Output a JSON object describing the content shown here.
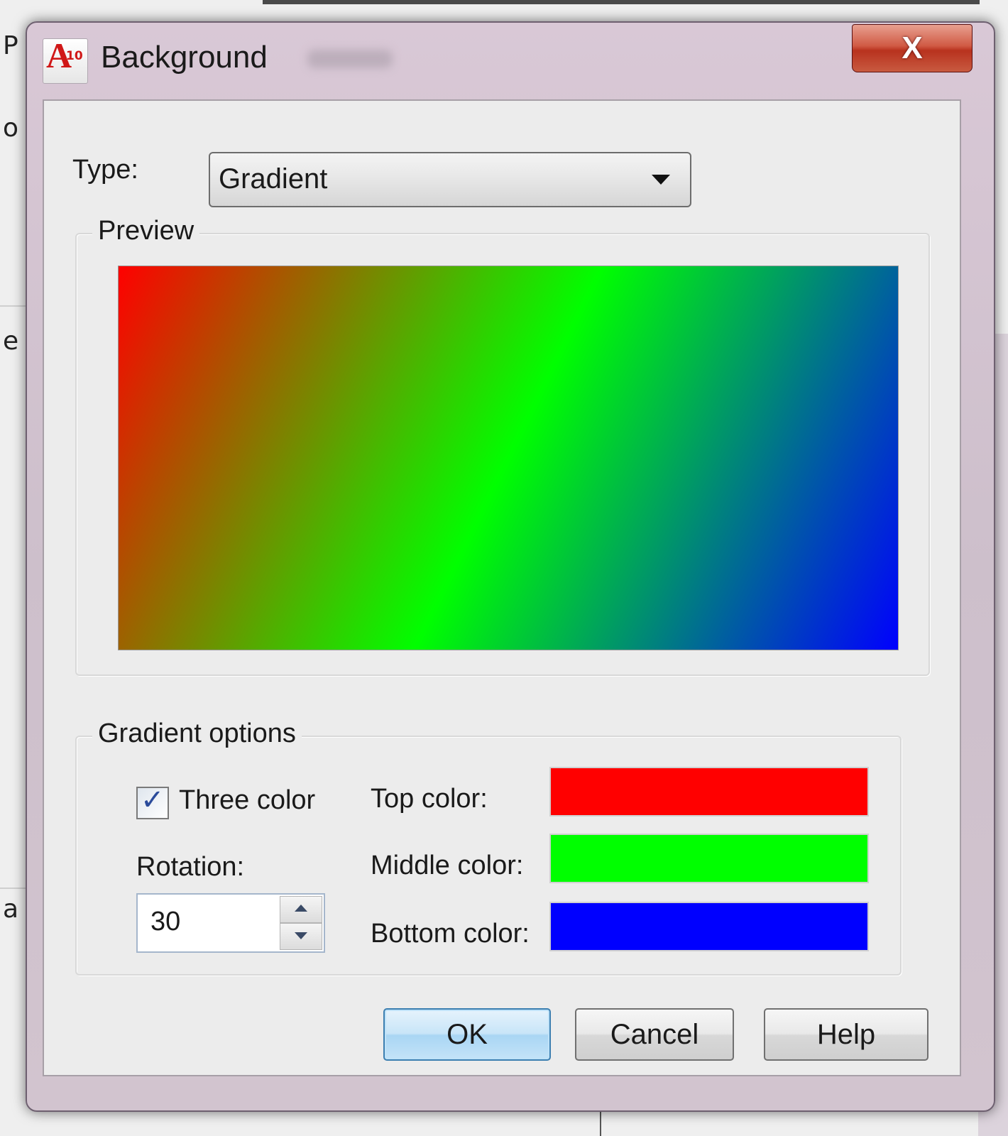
{
  "background": {
    "letters": [
      "P",
      "o",
      "e",
      "a"
    ]
  },
  "dialog": {
    "title": "Background",
    "app_icon_text": "A",
    "app_icon_sub": "10",
    "close_label": "X"
  },
  "type": {
    "label": "Type:",
    "selected": "Gradient"
  },
  "preview": {
    "legend": "Preview",
    "gradient_angle_deg": 30,
    "colors": {
      "top": "#ff0000",
      "middle": "#00ff00",
      "bottom": "#0000ff"
    }
  },
  "gradient_options": {
    "legend": "Gradient options",
    "three_color": {
      "label": "Three color",
      "checked": true
    },
    "rotation": {
      "label": "Rotation:",
      "value": "30"
    },
    "top_color": {
      "label": "Top color:",
      "color": "#ff0000"
    },
    "middle_color": {
      "label": "Middle color:",
      "color": "#00ff00"
    },
    "bottom_color": {
      "label": "Bottom color:",
      "color": "#0000ff"
    }
  },
  "buttons": {
    "ok": "OK",
    "cancel": "Cancel",
    "help": "Help"
  }
}
